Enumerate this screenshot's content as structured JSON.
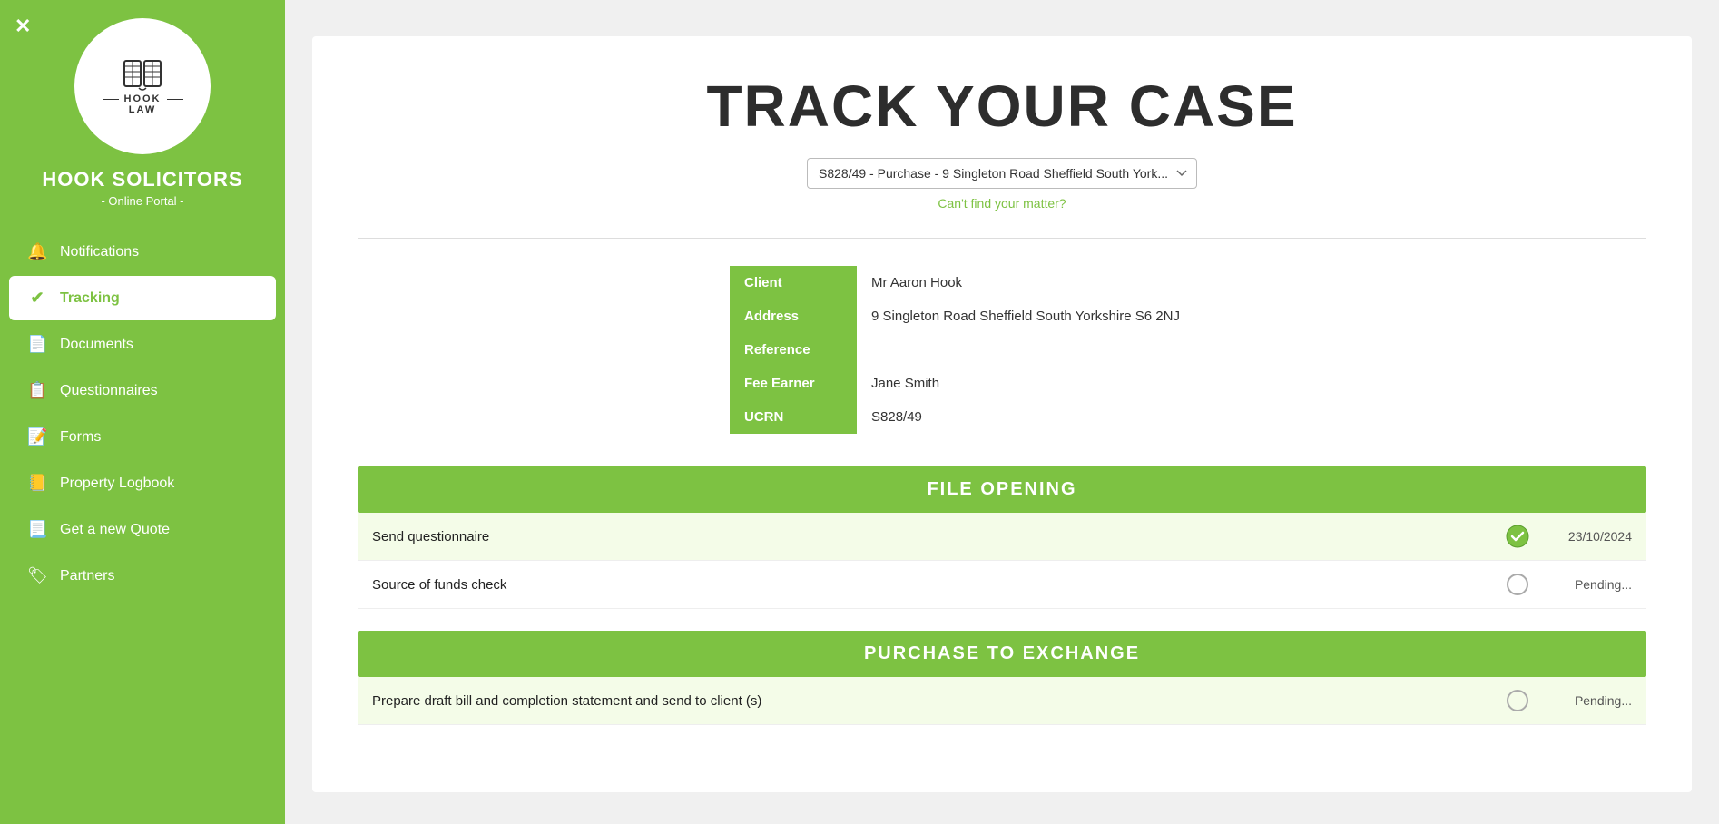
{
  "sidebar": {
    "close_label": "✕",
    "firm_name": "HOOK SOLICITORS",
    "subtitle": "- Online Portal -",
    "logo_icon": "📖",
    "logo_line1": "HOOK",
    "logo_line2": "LAW",
    "nav_items": [
      {
        "id": "notifications",
        "label": "Notifications",
        "icon": "🔔",
        "active": false
      },
      {
        "id": "tracking",
        "label": "Tracking",
        "icon": "✔",
        "active": true
      },
      {
        "id": "documents",
        "label": "Documents",
        "icon": "📄",
        "active": false
      },
      {
        "id": "questionnaires",
        "label": "Questionnaires",
        "icon": "📋",
        "active": false
      },
      {
        "id": "forms",
        "label": "Forms",
        "icon": "📝",
        "active": false
      },
      {
        "id": "property-logbook",
        "label": "Property Logbook",
        "icon": "📒",
        "active": false
      },
      {
        "id": "get-quote",
        "label": "Get a new Quote",
        "icon": "📃",
        "active": false
      },
      {
        "id": "partners",
        "label": "Partners",
        "icon": "🏷",
        "active": false
      }
    ]
  },
  "main": {
    "page_title": "TRACK YOUR CASE",
    "matter_select": {
      "value": "S828/49 - Purchase - 9 Singleton Road Sheffield South York...",
      "placeholder": "Select matter"
    },
    "cant_find_text": "Can't find your matter?",
    "client_fields": [
      {
        "label": "Client",
        "value": "Mr Aaron Hook"
      },
      {
        "label": "Address",
        "value": "9 Singleton Road Sheffield South Yorkshire S6 2NJ"
      },
      {
        "label": "Reference",
        "value": ""
      },
      {
        "label": "Fee Earner",
        "value": "Jane Smith"
      },
      {
        "label": "UCRN",
        "value": "S828/49"
      }
    ],
    "sections": [
      {
        "id": "file-opening",
        "title": "FILE OPENING",
        "tasks": [
          {
            "name": "Send questionnaire",
            "status": "done",
            "date": "23/10/2024"
          },
          {
            "name": "Source of funds check",
            "status": "pending",
            "date": "Pending..."
          }
        ]
      },
      {
        "id": "purchase-to-exchange",
        "title": "PURCHASE TO EXCHANGE",
        "tasks": [
          {
            "name": "Prepare draft bill and completion statement and send to client (s)",
            "status": "pending",
            "date": "Pending..."
          }
        ]
      }
    ]
  }
}
